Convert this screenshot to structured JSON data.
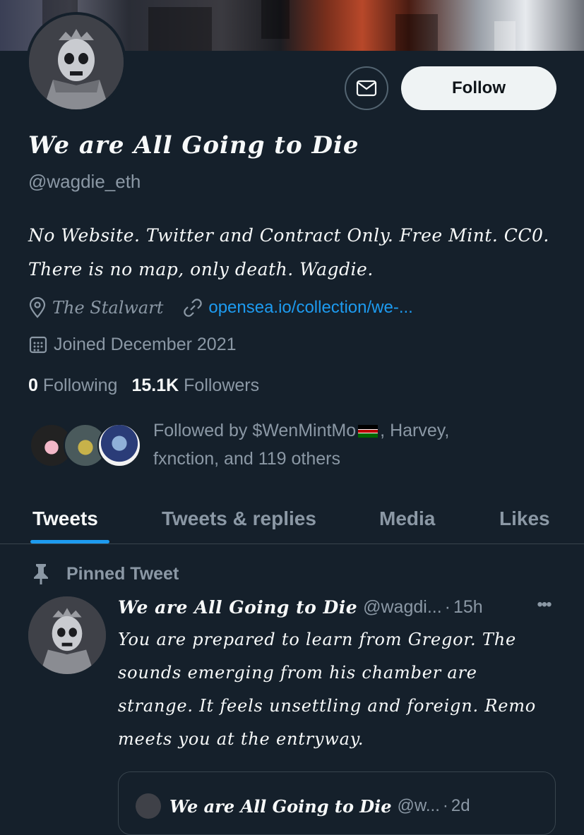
{
  "profile": {
    "display_name": "We are All Going to Die",
    "handle": "@wagdie_eth",
    "bio": "No Website. Twitter and Contract Only. Free Mint. CC0. There is no map, only death. Wagdie.",
    "location": "The Stalwart",
    "link": "opensea.io/collection/we-...",
    "joined": "Joined December 2021",
    "following_count": "0",
    "following_label": "Following",
    "followers_count": "15.1K",
    "followers_label": "Followers",
    "followed_by_line1": "Followed by $WenMintMo",
    "followed_by_line1_suffix": ", Harvey,",
    "followed_by_line2": "fxnction, and 119 others"
  },
  "actions": {
    "message_icon": "envelope-icon",
    "follow_label": "Follow"
  },
  "tabs": [
    {
      "label": "Tweets",
      "active": true
    },
    {
      "label": "Tweets & replies",
      "active": false
    },
    {
      "label": "Media",
      "active": false
    },
    {
      "label": "Likes",
      "active": false
    }
  ],
  "pinned_tweet": {
    "label": "Pinned Tweet",
    "author_name": "We are All Going to Die",
    "author_handle": "@wagdi...",
    "separator": "·",
    "time": "15h",
    "more": "•••",
    "text": "You are prepared to learn from Gregor. The sounds emerging from his chamber are strange. It feels unsettling and foreign. Remo meets you at the entryway.",
    "quoted": {
      "author_name": "We are All Going to Die",
      "author_handle": "@w...",
      "separator": "·",
      "time": "2d"
    }
  },
  "colors": {
    "background": "#15202b",
    "accent": "#1d9bf0",
    "muted_text": "#8b98a5",
    "border": "#38444d"
  }
}
